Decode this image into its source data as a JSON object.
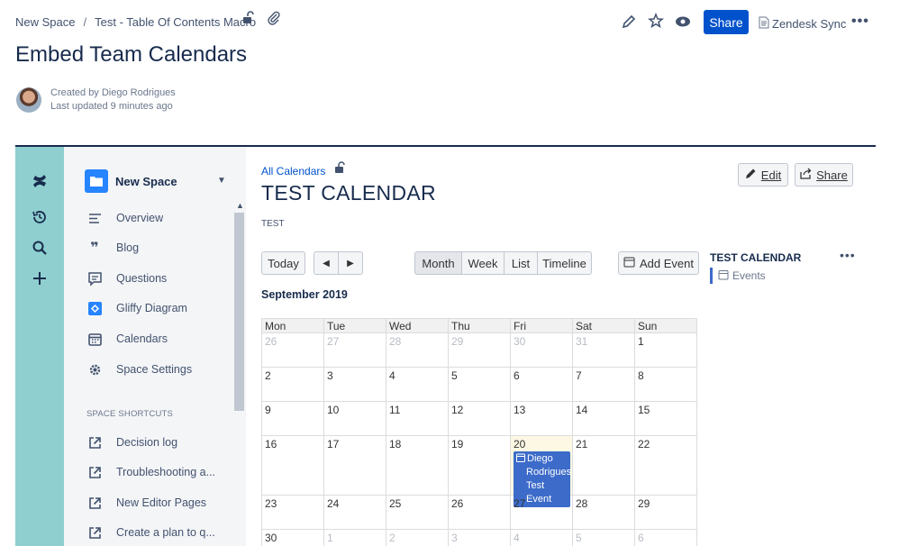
{
  "header": {
    "breadcrumbs": [
      "New Space",
      "Test - Table Of Contents Macro"
    ],
    "icons": [
      "restriction-unlock-icon",
      "attachment-icon"
    ],
    "actions": {
      "edit_icon": "pencil-icon",
      "star_icon": "star-icon",
      "watch_icon": "eye-icon",
      "share_label": "Share",
      "zendesk_label": "Zendesk Sync",
      "more_icon": "more-icon"
    },
    "page_title": "Embed Team Calendars",
    "created_by": "Created by Diego Rodrigues",
    "last_updated": "Last updated 9 minutes ago"
  },
  "rail": {
    "icons": [
      "confluence-logo-icon",
      "recent-icon",
      "search-icon",
      "create-icon"
    ]
  },
  "sidebar": {
    "space_name": "New Space",
    "items": [
      {
        "label": "Overview",
        "icon": "overview-icon"
      },
      {
        "label": "Blog",
        "icon": "blog-icon"
      },
      {
        "label": "Questions",
        "icon": "questions-icon"
      },
      {
        "label": "Gliffy Diagram",
        "icon": "gliffy-icon"
      },
      {
        "label": "Calendars",
        "icon": "calendar-icon"
      },
      {
        "label": "Space Settings",
        "icon": "gear-icon"
      }
    ],
    "shortcuts_heading": "SPACE SHORTCUTS",
    "shortcuts": [
      {
        "label": "Decision log",
        "icon": "external-link-icon"
      },
      {
        "label": "Troubleshooting a...",
        "icon": "external-link-icon"
      },
      {
        "label": "New Editor Pages",
        "icon": "external-link-icon"
      },
      {
        "label": "Create a plan to q...",
        "icon": "external-link-icon"
      }
    ]
  },
  "calendar": {
    "all_calendars_link": "All Calendars",
    "title": "TEST CALENDAR",
    "subtitle": "TEST",
    "edit_label": "Edit",
    "share_label": "Share",
    "today_label": "Today",
    "prev_label": "◀",
    "next_label": "▶",
    "views": [
      "Month",
      "Week",
      "List",
      "Timeline"
    ],
    "active_view": "Month",
    "add_event_label": "Add Event",
    "month_label": "September 2019",
    "weekdays": [
      "Mon",
      "Tue",
      "Wed",
      "Thu",
      "Fri",
      "Sat",
      "Sun"
    ],
    "weeks": [
      [
        {
          "d": "26",
          "o": true
        },
        {
          "d": "27",
          "o": true
        },
        {
          "d": "28",
          "o": true
        },
        {
          "d": "29",
          "o": true
        },
        {
          "d": "30",
          "o": true
        },
        {
          "d": "31",
          "o": true
        },
        {
          "d": "1",
          "o": false
        }
      ],
      [
        {
          "d": "2",
          "o": false
        },
        {
          "d": "3",
          "o": false
        },
        {
          "d": "4",
          "o": false
        },
        {
          "d": "5",
          "o": false
        },
        {
          "d": "6",
          "o": false
        },
        {
          "d": "7",
          "o": false
        },
        {
          "d": "8",
          "o": false
        }
      ],
      [
        {
          "d": "9",
          "o": false
        },
        {
          "d": "10",
          "o": false
        },
        {
          "d": "11",
          "o": false
        },
        {
          "d": "12",
          "o": false
        },
        {
          "d": "13",
          "o": false
        },
        {
          "d": "14",
          "o": false
        },
        {
          "d": "15",
          "o": false
        }
      ],
      [
        {
          "d": "16",
          "o": false
        },
        {
          "d": "17",
          "o": false
        },
        {
          "d": "18",
          "o": false
        },
        {
          "d": "19",
          "o": false
        },
        {
          "d": "20",
          "o": false,
          "today": true
        },
        {
          "d": "21",
          "o": false
        },
        {
          "d": "22",
          "o": false
        }
      ],
      [
        {
          "d": "23",
          "o": false
        },
        {
          "d": "24",
          "o": false
        },
        {
          "d": "25",
          "o": false
        },
        {
          "d": "26",
          "o": false
        },
        {
          "d": "27",
          "o": false
        },
        {
          "d": "28",
          "o": false
        },
        {
          "d": "29",
          "o": false
        }
      ],
      [
        {
          "d": "30",
          "o": false
        },
        {
          "d": "1",
          "o": true
        },
        {
          "d": "2",
          "o": true
        },
        {
          "d": "3",
          "o": true
        },
        {
          "d": "4",
          "o": true
        },
        {
          "d": "5",
          "o": true
        },
        {
          "d": "6",
          "o": true
        }
      ]
    ],
    "event": {
      "lines": [
        "Diego",
        "Rodrigues:",
        "Test Event"
      ],
      "color": "#3c6bc9"
    },
    "side_panel": {
      "title": "TEST CALENDAR",
      "events_label": "Events"
    }
  },
  "colors": {
    "primary": "#0052cc",
    "rail": "#8fcfcf",
    "sidebar": "#f4f5f7",
    "today": "#fcf8e3"
  }
}
